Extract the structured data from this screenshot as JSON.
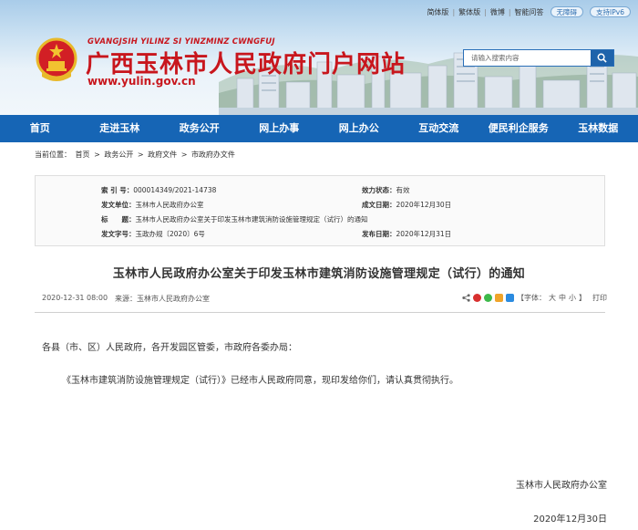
{
  "top_links": {
    "simplified": "简体版",
    "traditional": "繁体版",
    "weibo": "微博",
    "wechat": "智能问答",
    "accessible": "无障碍",
    "ipv6": "支持IPv6"
  },
  "site": {
    "pinyin": "GVANGJSIH YILINZ SI YINZMINZ CWNGFUJ",
    "title": "广西玉林市人民政府门户网站",
    "domain": "www.yulin.gov.cn"
  },
  "search": {
    "placeholder": "请输入搜索内容"
  },
  "nav": [
    "首页",
    "走进玉林",
    "政务公开",
    "网上办事",
    "网上办公",
    "互动交流",
    "便民利企服务",
    "玉林数据"
  ],
  "breadcrumb": [
    "当前位置：",
    "首页",
    ">",
    "政务公开",
    ">",
    "政府文件",
    ">",
    "市政府办文件"
  ],
  "info": {
    "index_label": "索 引 号：",
    "index_value": "000014349/2021-14738",
    "status_label": "效力状态：",
    "status_value": "有效",
    "issuer_label": "发文单位：",
    "issuer_value": "玉林市人民政府办公室",
    "created_label": "成文日期：",
    "created_value": "2020年12月30日",
    "title_label": "标　　题：",
    "title_value": "玉林市人民政府办公室关于印发玉林市建筑消防设施管理规定（试行）的通知",
    "docno_label": "发文字号：",
    "docno_value": "玉政办规〔2020〕6号",
    "published_label": "发布日期：",
    "published_value": "2020年12月31日"
  },
  "article": {
    "title": "玉林市人民政府办公室关于印发玉林市建筑消防设施管理规定（试行）的通知",
    "date": "2020-12-31 08:00",
    "source": "来源：玉林市人民政府办公室",
    "font_label": "【字体：",
    "font_large": "大",
    "font_medium": "中",
    "font_small": "小",
    "font_close": "】",
    "print": "打印",
    "salutation": "各县（市、区）人民政府，各开发园区管委，市政府各委办局：",
    "paragraph": "《玉林市建筑消防设施管理规定（试行）》已经市人民政府同意，现印发给你们，请认真贯彻执行。",
    "sign_org": "玉林市人民政府办公室",
    "sign_date": "2020年12月30日"
  },
  "colors": {
    "brand_red": "#c8161d",
    "nav_blue": "#1665b5",
    "search_blue": "#1e63ab"
  }
}
